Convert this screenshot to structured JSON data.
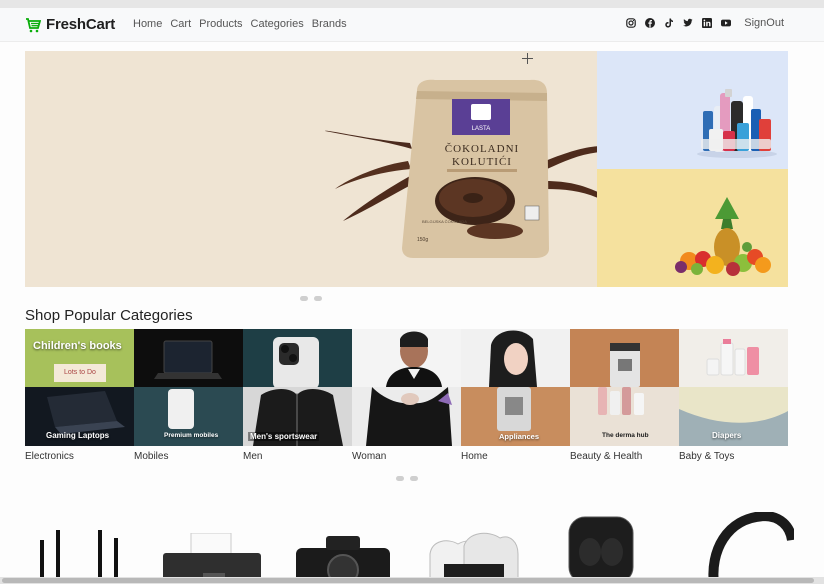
{
  "navbar": {
    "brand": "FreshCart",
    "links": [
      "Home",
      "Cart",
      "Products",
      "Categories",
      "Brands"
    ],
    "social_icons": [
      "instagram-icon",
      "facebook-icon",
      "tiktok-icon",
      "twitter-icon",
      "linkedin-icon",
      "youtube-icon"
    ],
    "signout": "SignOut"
  },
  "hero": {
    "product_brand": "LASTA",
    "product_name_line1": "ČOKOLADNI",
    "product_name_line2": "KOLUTIĆI",
    "product_small_text": "BELGIJSKA ČOKOLADA",
    "product_weight": "150g"
  },
  "section": {
    "title": "Shop Popular Categories"
  },
  "categories": [
    {
      "label": "Electronics",
      "overlay_top": "Children's books",
      "overlay_bottom": "Gaming Laptops",
      "book_text": "Lots to Do"
    },
    {
      "label": "Mobiles",
      "overlay_bottom": "Premium mobiles"
    },
    {
      "label": "Men",
      "overlay_bottom": "Men's sportswear"
    },
    {
      "label": "Woman"
    },
    {
      "label": "Home",
      "overlay_bottom": "Appliances"
    },
    {
      "label": "Beauty & Health",
      "overlay_bottom": "The derma hub"
    },
    {
      "label": "Baby & Toys",
      "overlay_bottom": "Diapers"
    }
  ],
  "colors": {
    "brand_green": "#0aad0a",
    "hero_bg": "#efe4d3",
    "side_blue": "#dce6f8",
    "side_yellow": "#f5e19e"
  }
}
